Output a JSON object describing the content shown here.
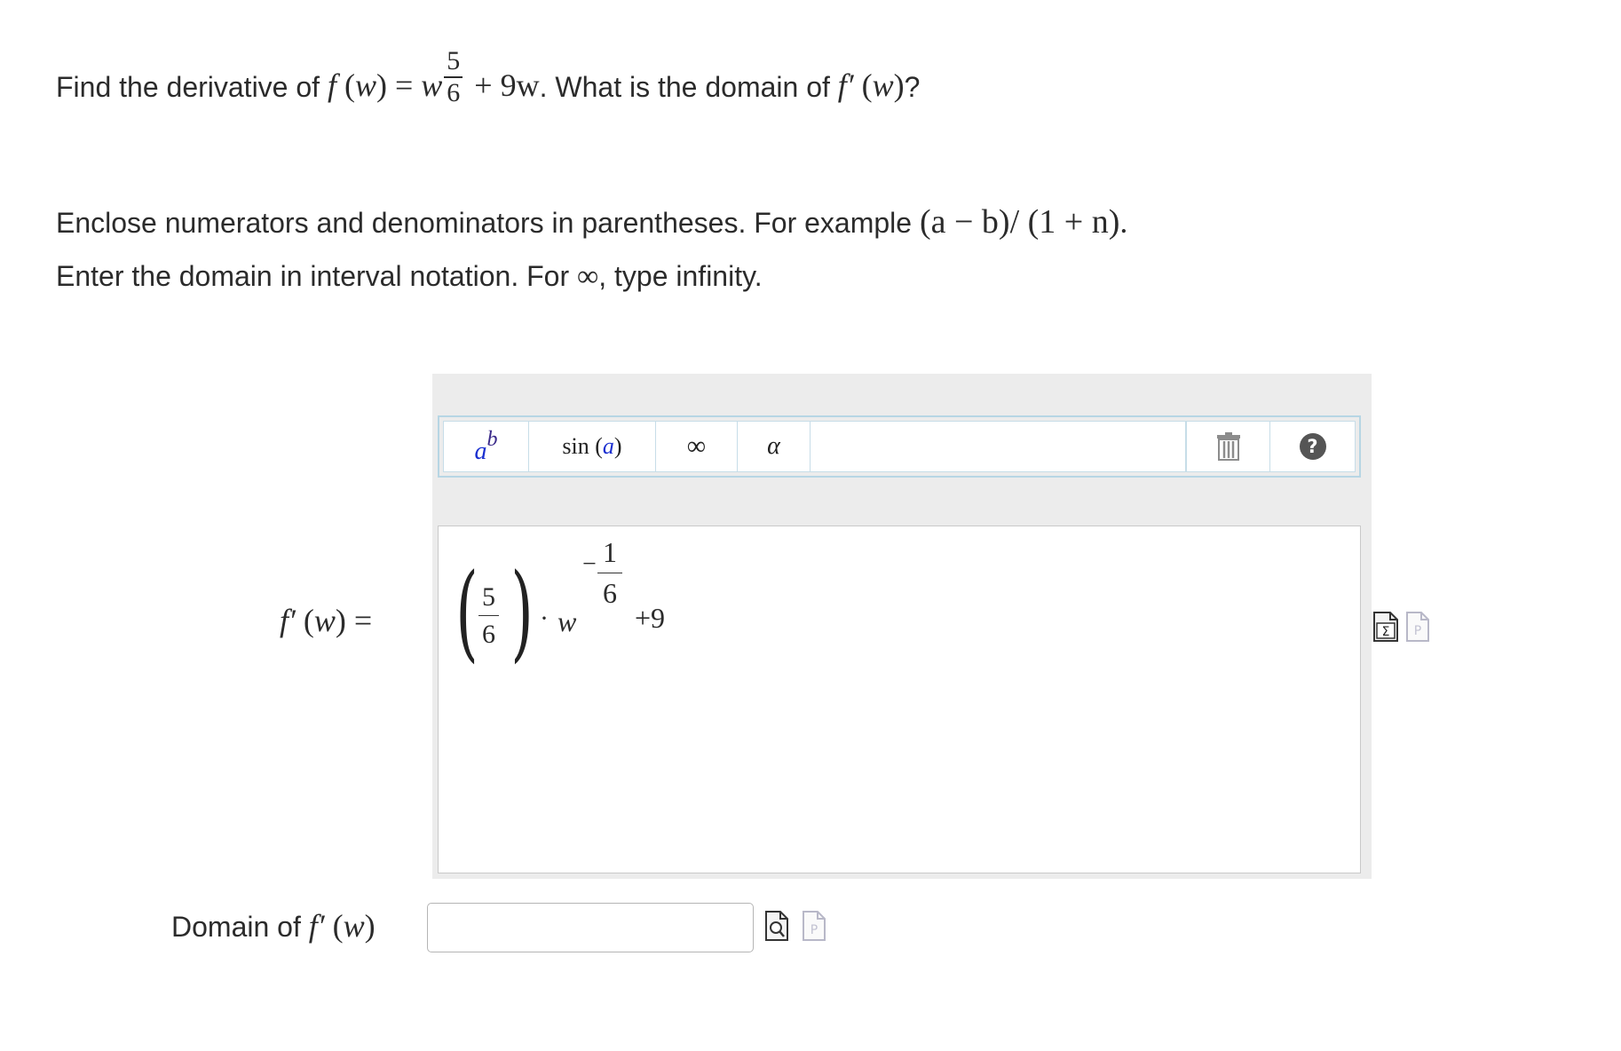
{
  "question": {
    "prefix": "Find the derivative of",
    "func_name": "f",
    "var": "w",
    "equals": "=",
    "base": "w",
    "exp_num": "5",
    "exp_den": "6",
    "plus_term": "+ 9w",
    "mid_text": ". What is the domain of",
    "deriv_name": "f′",
    "suffix": "?"
  },
  "instructions": {
    "line1_text": "Enclose numerators and denominators in parentheses. For example",
    "line1_example": "(a − b)/ (1 + n)",
    "line1_end": ".",
    "line2_prefix": "Enter the domain in interval notation. For",
    "line2_symbol": "∞",
    "line2_suffix": ", type infinity."
  },
  "toolbar": {
    "power_base": "a",
    "power_exp": "b",
    "sin_fn": "sin",
    "sin_arg": "a",
    "infinity": "∞",
    "alpha": "α",
    "trash_icon": "trash-icon",
    "help_icon": "help-icon",
    "help_glyph": "?"
  },
  "answer": {
    "label_name": "f′",
    "label_var": "w",
    "label_equals": "=",
    "coef_num": "5",
    "coef_den": "6",
    "dot": "·",
    "base": "w",
    "exp_sign": "−",
    "exp_num": "1",
    "exp_den": "6",
    "plus": "+9"
  },
  "domain": {
    "label_prefix": "Domain of",
    "label_name": "f′",
    "label_var": "w",
    "value": "",
    "placeholder": ""
  },
  "colors": {
    "toolbar_border": "#b7d6e4",
    "editor_bg": "#ececec",
    "text": "#2b2b2b",
    "accent_blue": "#1a2fd0"
  }
}
